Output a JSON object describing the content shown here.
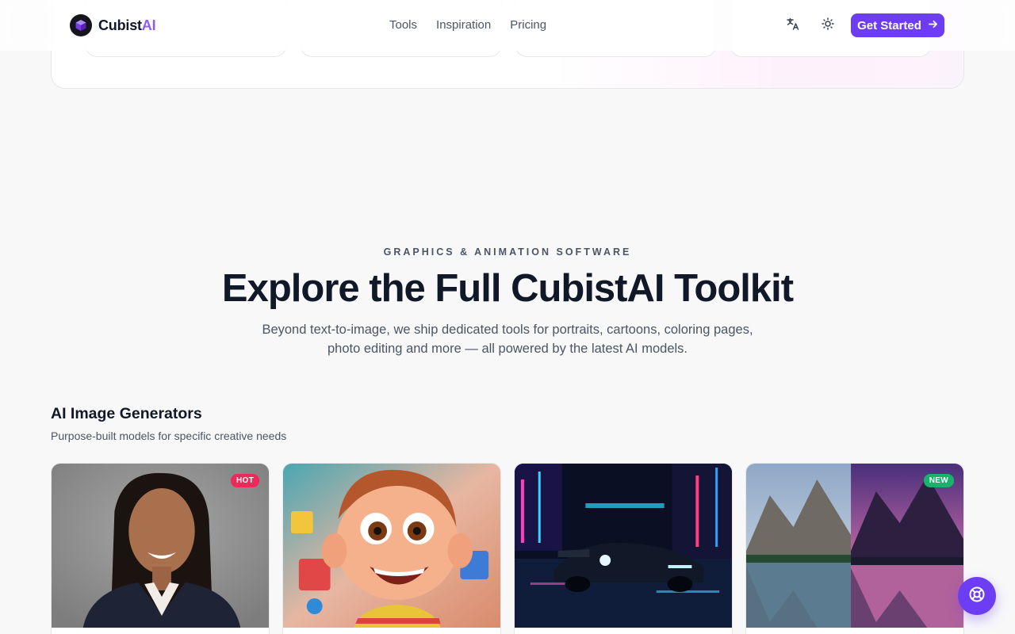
{
  "header": {
    "logo_main": "Cubist",
    "logo_accent": "AI",
    "nav": [
      "Tools",
      "Inspiration",
      "Pricing"
    ],
    "icons": {
      "language": "translate-icon",
      "theme": "sun-icon"
    },
    "cta_label": "Get Started"
  },
  "hero": {
    "eyebrow": "GRAPHICS & ANIMATION SOFTWARE",
    "title": "Explore the Full CubistAI Toolkit",
    "subtitle_line1": "Beyond text-to-image, we ship dedicated tools for portraits, cartoons, coloring pages,",
    "subtitle_line2": "photo editing and more — all powered by the latest AI models."
  },
  "section": {
    "title": "AI Image Generators",
    "subtitle": "Purpose-built models for specific creative needs",
    "cards": [
      {
        "image": "professional-portrait",
        "badge": "HOT"
      },
      {
        "image": "cartoon-boy",
        "badge": ""
      },
      {
        "image": "neon-city-car",
        "badge": ""
      },
      {
        "image": "mountain-lake-comparison",
        "badge": "NEW"
      }
    ]
  },
  "colors": {
    "accent": "#6d3df5",
    "logo_accent": "#8b5cf6",
    "hot": "#ef2a5b",
    "new": "#18b26b"
  }
}
